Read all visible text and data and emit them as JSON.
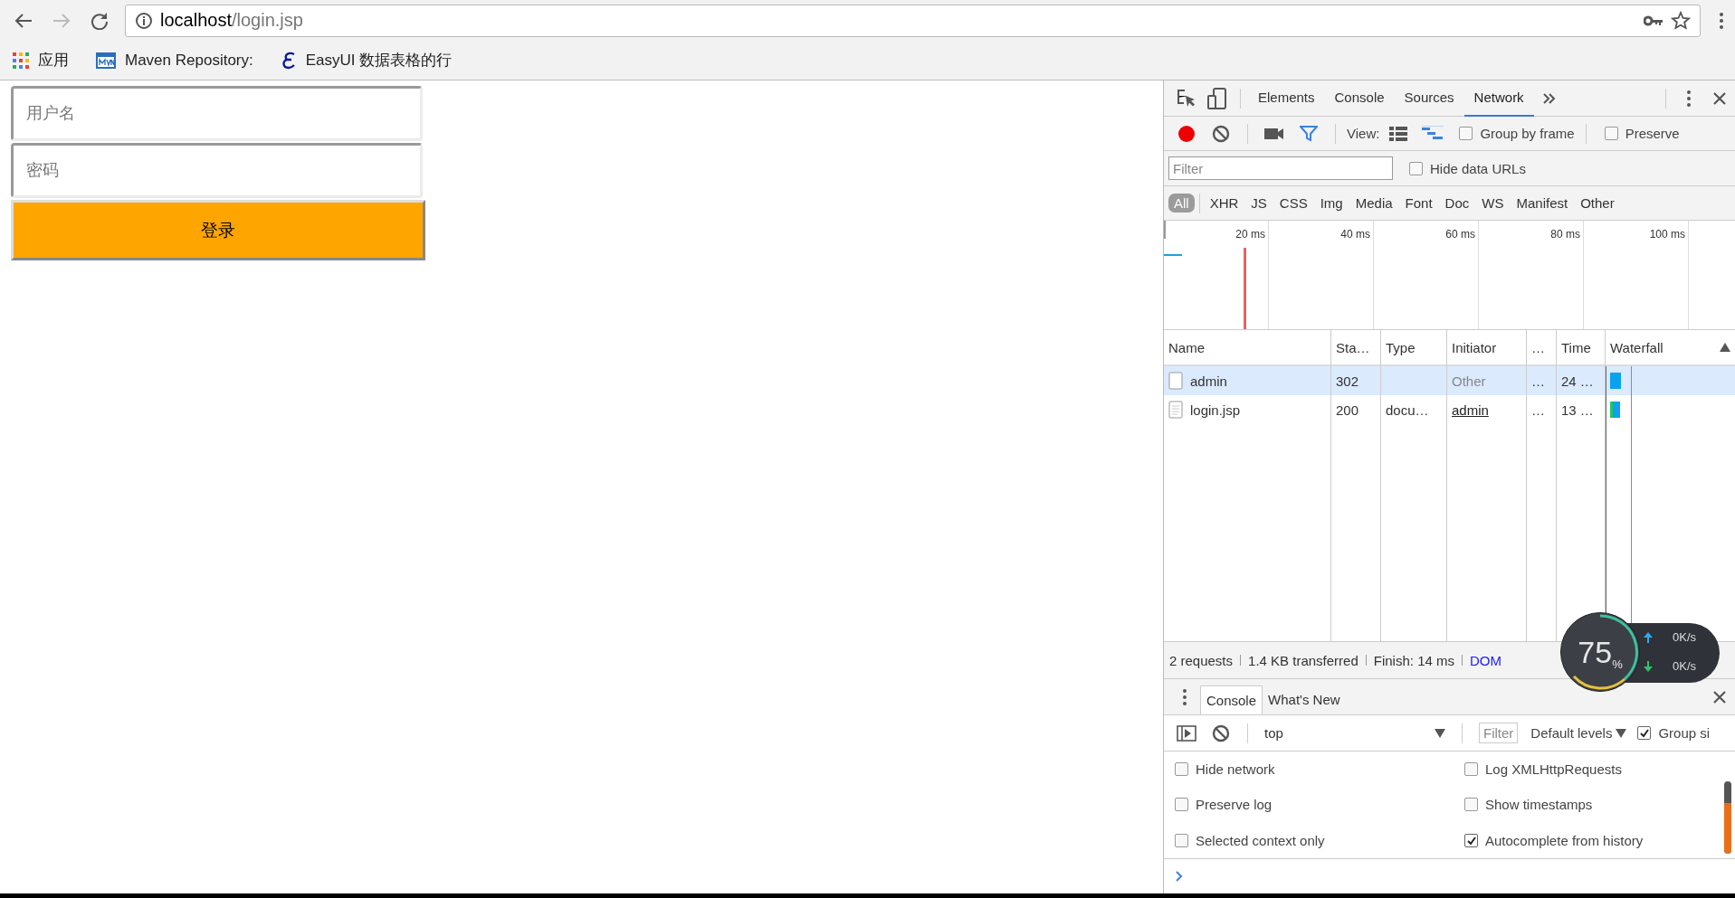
{
  "browser": {
    "url_host": "localhost",
    "url_path": "/login.jsp",
    "bookmarks": [
      {
        "kind": "apps",
        "label": "应用"
      },
      {
        "kind": "mvn",
        "label": "Maven Repository:"
      },
      {
        "kind": "easyui",
        "label": "EasyUI 数据表格的行"
      }
    ]
  },
  "page": {
    "username_placeholder": "用户名",
    "password_placeholder": "密码",
    "login_button": "登录"
  },
  "devtools": {
    "tabs": [
      {
        "label": "Elements",
        "selected": false
      },
      {
        "label": "Console",
        "selected": false
      },
      {
        "label": "Sources",
        "selected": false
      },
      {
        "label": "Network",
        "selected": true
      }
    ],
    "toolbar": {
      "recording": true,
      "view_label": "View:",
      "options": [
        {
          "label": "Group by frame",
          "checked": false
        },
        {
          "label": "Preserve",
          "checked": false
        }
      ]
    },
    "filter": {
      "placeholder": "Filter",
      "hide_data_urls": {
        "label": "Hide data URLs",
        "checked": false
      }
    },
    "types": [
      {
        "label": "All",
        "selected": true
      },
      {
        "label": "XHR",
        "selected": false
      },
      {
        "label": "JS",
        "selected": false
      },
      {
        "label": "CSS",
        "selected": false
      },
      {
        "label": "Img",
        "selected": false
      },
      {
        "label": "Media",
        "selected": false
      },
      {
        "label": "Font",
        "selected": false
      },
      {
        "label": "Doc",
        "selected": false
      },
      {
        "label": "WS",
        "selected": false
      },
      {
        "label": "Manifest",
        "selected": false
      },
      {
        "label": "Other",
        "selected": false
      }
    ],
    "overview_ticks": [
      "20 ms",
      "40 ms",
      "60 ms",
      "80 ms",
      "100 ms"
    ],
    "table": {
      "columns": [
        "Name",
        "Sta…",
        "Type",
        "Initiator",
        "…",
        "Time",
        "Waterfall"
      ],
      "rows": [
        {
          "name": "admin",
          "status": "302",
          "initiator": "Other",
          "initiator_link": false,
          "column_5": "…",
          "time": "24 …",
          "selected": true
        },
        {
          "name": "login.jsp",
          "status": "200",
          "type": "docu…",
          "initiator": "admin",
          "initiator_link": true,
          "column_5": "…",
          "time": "13 …",
          "selected": false
        }
      ]
    },
    "status": [
      {
        "kind": "text",
        "label": "2 requests"
      },
      {
        "kind": "text",
        "label": "1.4 KB transferred"
      },
      {
        "kind": "text",
        "label": "Finish: 14 ms"
      },
      {
        "kind": "link",
        "label": "DOM"
      }
    ],
    "speed_widget": {
      "percent": "75",
      "unit": "%",
      "up": "0K/s",
      "down": "0K/s"
    },
    "drawer": {
      "tabs": [
        {
          "label": "Console",
          "selected": true
        },
        {
          "label": "What's New",
          "selected": false
        }
      ],
      "context": "top",
      "filter_placeholder": "Filter",
      "levels": "Default levels",
      "group_similar": {
        "label": "Group si",
        "checked": true
      },
      "settings": [
        {
          "label": "Hide network",
          "checked": false
        },
        {
          "label": "Log XMLHttpRequests",
          "checked": false
        },
        {
          "label": "Preserve log",
          "checked": false
        },
        {
          "label": "Show timestamps",
          "checked": false
        },
        {
          "label": "Selected context only",
          "checked": false
        },
        {
          "label": "Autocomplete from history",
          "checked": true
        }
      ]
    }
  }
}
